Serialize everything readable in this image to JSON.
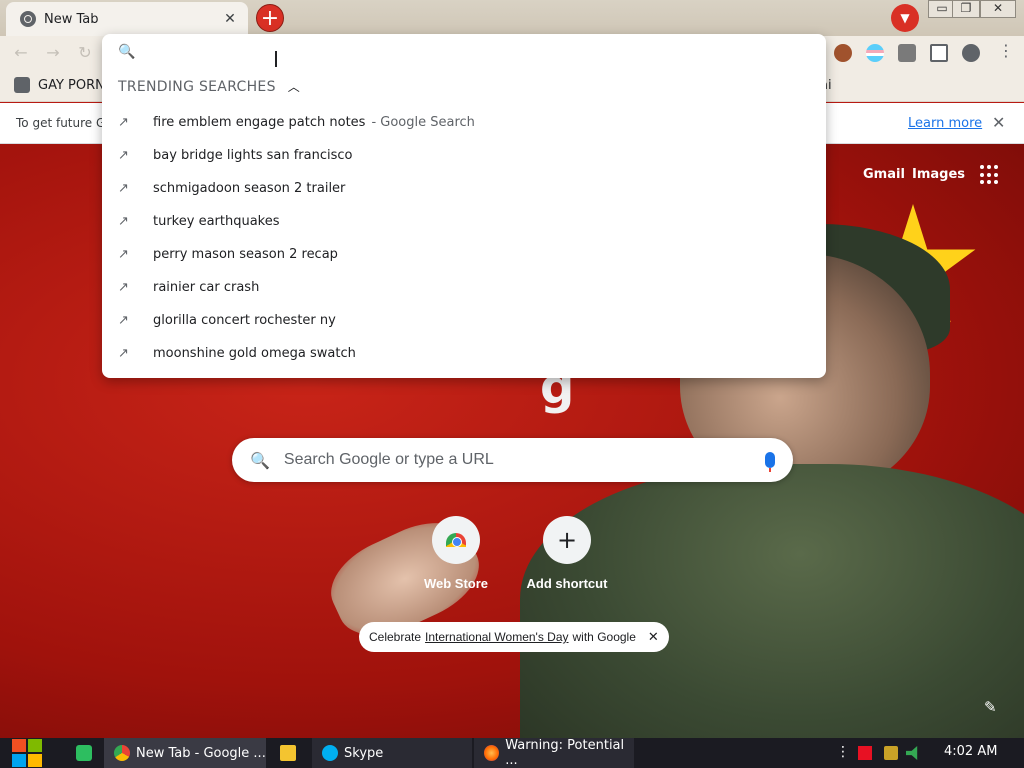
{
  "browser": {
    "tab": {
      "title": "New Tab",
      "close": "✕"
    },
    "new_tab_icon": "+",
    "tab_search_icon": "▼",
    "window_controls": {
      "minimize": "▭",
      "restore": "❐",
      "close": "✕"
    },
    "nav": {
      "back": "←",
      "forward": "→",
      "reload": "↻"
    },
    "menu_icon": "⋮"
  },
  "bookmarks": {
    "first": "GAY PORN",
    "right": "ai"
  },
  "infobar": {
    "text": "To get future G",
    "learn_more": "Learn more",
    "close": "✕"
  },
  "omnibox": {
    "value": "",
    "search_icon": "🔍",
    "trending_header": "TRENDING SEARCHES",
    "collapse_icon": "︿",
    "trend_icon": "↗",
    "suggestions": [
      {
        "text": "fire emblem engage patch notes",
        "sub": "- Google Search"
      },
      {
        "text": "bay bridge lights san francisco",
        "sub": ""
      },
      {
        "text": "schmigadoon season 2 trailer",
        "sub": ""
      },
      {
        "text": "turkey earthquakes",
        "sub": ""
      },
      {
        "text": "perry mason season 2 recap",
        "sub": ""
      },
      {
        "text": "rainier car crash",
        "sub": ""
      },
      {
        "text": "glorilla concert rochester ny",
        "sub": ""
      },
      {
        "text": "moonshine gold omega swatch",
        "sub": ""
      }
    ]
  },
  "ntp": {
    "gmail": "Gmail",
    "images": "Images",
    "logo_letter": "g",
    "search_placeholder": "Search Google or type a URL",
    "search_icon": "🔍",
    "shortcuts": [
      {
        "label": "Web Store"
      },
      {
        "label": "Add shortcut",
        "icon": "+"
      }
    ],
    "promo": {
      "before": "Celebrate",
      "link": "International Women's Day",
      "after": "with Google",
      "close": "✕"
    },
    "edit_icon": "✎"
  },
  "taskbar": {
    "apps": [
      {
        "label": "New Tab - Google ..."
      },
      {
        "label": "Skype"
      },
      {
        "label": "Warning: Potential ..."
      }
    ],
    "tray_more": "⋮",
    "clock": "4:02 AM"
  },
  "colors": {
    "accent_red": "#d93025",
    "link_blue": "#1a73e8",
    "taskbar": "#1b1b22",
    "wallpaper_red": "#b81a12",
    "star_yellow": "#ffd21a"
  }
}
